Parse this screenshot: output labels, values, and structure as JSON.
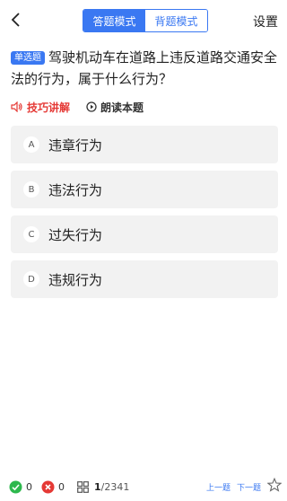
{
  "header": {
    "modes": [
      "答题模式",
      "背题模式"
    ],
    "active_mode": "答题模式",
    "settings_label": "设置"
  },
  "question": {
    "type_badge": "单选题",
    "text": "驾驶机动车在道路上违反道路交通安全法的行为，属于什么行为？"
  },
  "tools": {
    "tips_label": "技巧讲解",
    "read_label": "朗读本题"
  },
  "options": [
    {
      "letter": "A",
      "text": "违章行为"
    },
    {
      "letter": "B",
      "text": "违法行为"
    },
    {
      "letter": "C",
      "text": "过失行为"
    },
    {
      "letter": "D",
      "text": "违规行为"
    }
  ],
  "footer": {
    "correct_count": "0",
    "wrong_count": "0",
    "current": "1",
    "total": "/2341",
    "prev_label": "上一题",
    "next_label": "下一题"
  },
  "colors": {
    "accent": "#3a78f2",
    "tips_red": "#e53935",
    "correct_green": "#2db84d",
    "wrong_red": "#e53935"
  },
  "icons": [
    "back-arrow-icon",
    "speaker-icon",
    "play-icon",
    "check-icon",
    "cross-icon",
    "grid-icon",
    "star-icon"
  ]
}
